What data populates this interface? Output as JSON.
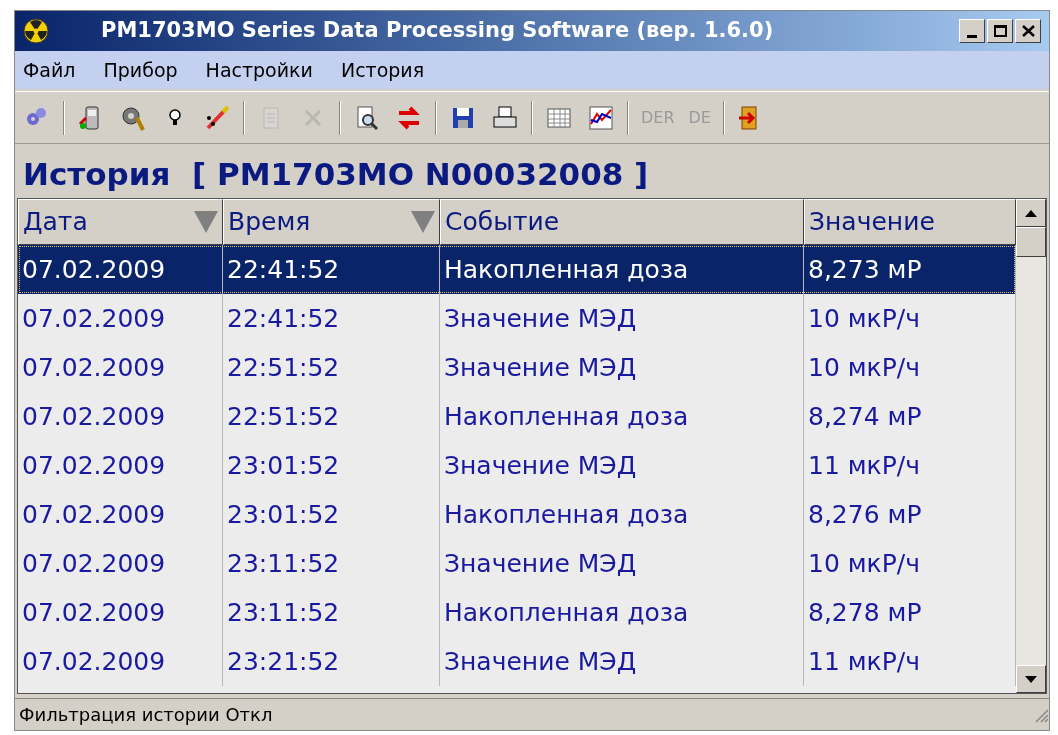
{
  "window": {
    "title": "PM1703MO Series Data Processing Software (вер. 1.6.0)"
  },
  "menu": [
    {
      "label": "Файл"
    },
    {
      "label": "Прибор"
    },
    {
      "label": "Настройки"
    },
    {
      "label": "История"
    }
  ],
  "toolbar": [
    {
      "kind": "gears",
      "disabled": false
    },
    {
      "kind": "separator"
    },
    {
      "kind": "device",
      "disabled": false
    },
    {
      "kind": "gear-tool",
      "disabled": false
    },
    {
      "kind": "bulb",
      "disabled": false
    },
    {
      "kind": "wand",
      "disabled": false
    },
    {
      "kind": "separator"
    },
    {
      "kind": "clipboard",
      "disabled": true
    },
    {
      "kind": "delete",
      "disabled": true
    },
    {
      "kind": "separator"
    },
    {
      "kind": "preview",
      "disabled": false
    },
    {
      "kind": "arrows",
      "disabled": false
    },
    {
      "kind": "separator"
    },
    {
      "kind": "save",
      "disabled": false
    },
    {
      "kind": "print",
      "disabled": false
    },
    {
      "kind": "separator"
    },
    {
      "kind": "table",
      "disabled": false
    },
    {
      "kind": "chart",
      "disabled": false
    },
    {
      "kind": "separator"
    },
    {
      "kind": "text",
      "label": "DER",
      "disabled": true
    },
    {
      "kind": "text",
      "label": "DE",
      "disabled": true
    },
    {
      "kind": "separator"
    },
    {
      "kind": "exit",
      "disabled": false
    }
  ],
  "heading": "История  [ PM1703MO N00032008 ]",
  "table": {
    "columns": [
      {
        "label": "Дата",
        "sortable": true
      },
      {
        "label": "Время",
        "sortable": true
      },
      {
        "label": "Событие",
        "sortable": false
      },
      {
        "label": "Значение",
        "sortable": false
      }
    ],
    "rows": [
      {
        "cells": [
          "07.02.2009",
          "22:41:52",
          "Накопленная доза",
          "8,273 мР"
        ],
        "selected": true
      },
      {
        "cells": [
          "07.02.2009",
          "22:41:52",
          "Значение МЭД",
          "10 мкР/ч"
        ],
        "selected": false
      },
      {
        "cells": [
          "07.02.2009",
          "22:51:52",
          "Значение МЭД",
          "10 мкР/ч"
        ],
        "selected": false
      },
      {
        "cells": [
          "07.02.2009",
          "22:51:52",
          "Накопленная доза",
          "8,274 мР"
        ],
        "selected": false
      },
      {
        "cells": [
          "07.02.2009",
          "23:01:52",
          "Значение МЭД",
          "11 мкР/ч"
        ],
        "selected": false
      },
      {
        "cells": [
          "07.02.2009",
          "23:01:52",
          "Накопленная доза",
          "8,276 мР"
        ],
        "selected": false
      },
      {
        "cells": [
          "07.02.2009",
          "23:11:52",
          "Значение МЭД",
          "10 мкР/ч"
        ],
        "selected": false
      },
      {
        "cells": [
          "07.02.2009",
          "23:11:52",
          "Накопленная доза",
          "8,278 мР"
        ],
        "selected": false
      },
      {
        "cells": [
          "07.02.2009",
          "23:21:52",
          "Значение МЭД",
          "11 мкР/ч"
        ],
        "selected": false
      }
    ]
  },
  "status_bar": {
    "text": "Фильтрация истории Откл"
  }
}
